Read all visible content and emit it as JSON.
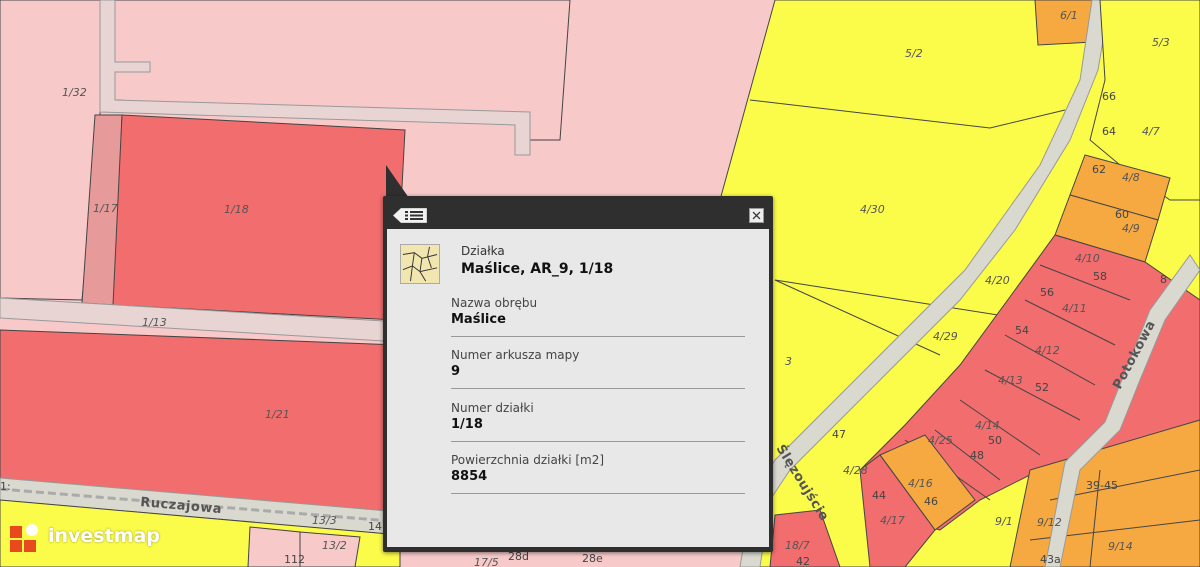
{
  "map": {
    "parcel_labels": [
      "6/1",
      "5/2",
      "5/3",
      "66",
      "64",
      "4/7",
      "1/32",
      "62",
      "4/8",
      "60",
      "4/9",
      "1/17",
      "1/18",
      "4/30",
      "4/10",
      "58",
      "4/20",
      "56",
      "4/11",
      "1/13",
      "54",
      "4/12",
      "4/29",
      "3",
      "4/13",
      "52",
      "1/21",
      "4/14",
      "50",
      "47",
      "4/25",
      "48",
      "4/28",
      "4/16",
      "46",
      "44",
      "4/17",
      "39-45",
      "8",
      "9/1",
      "9/12",
      "13/3",
      "13/2",
      "9/14",
      "43a",
      "18/7",
      "42",
      "28e",
      "28d",
      "17/5",
      "14",
      "112",
      "1:"
    ],
    "streets": {
      "ruczajowa": "Ruczajowa",
      "potokowa": "Potokowa",
      "slezoujscie": "Ślęzoujście"
    }
  },
  "popup": {
    "layer_type": "Działka",
    "title": "Maślice, AR_9, 1/18",
    "fields": [
      {
        "label": "Nazwa obrębu",
        "value": "Maślice"
      },
      {
        "label": "Numer arkusza mapy",
        "value": "9"
      },
      {
        "label": "Numer działki",
        "value": "1/18"
      },
      {
        "label": "Powierzchnia działki [m2]",
        "value": "8854"
      }
    ],
    "icons": {
      "list": "list-icon",
      "close": "close-icon",
      "thumbnail": "parcel-map-thumbnail"
    }
  },
  "logo": {
    "text": "investmap"
  },
  "colors": {
    "light_pink": "#f7c9c9",
    "red": "#f26d6d",
    "yellow": "#fbfb4a",
    "orange": "#f6a940",
    "road": "#d9d9d0",
    "popup_frame": "#2f2f2f",
    "popup_body": "#e8e8e8",
    "logo": "#e8491d"
  }
}
